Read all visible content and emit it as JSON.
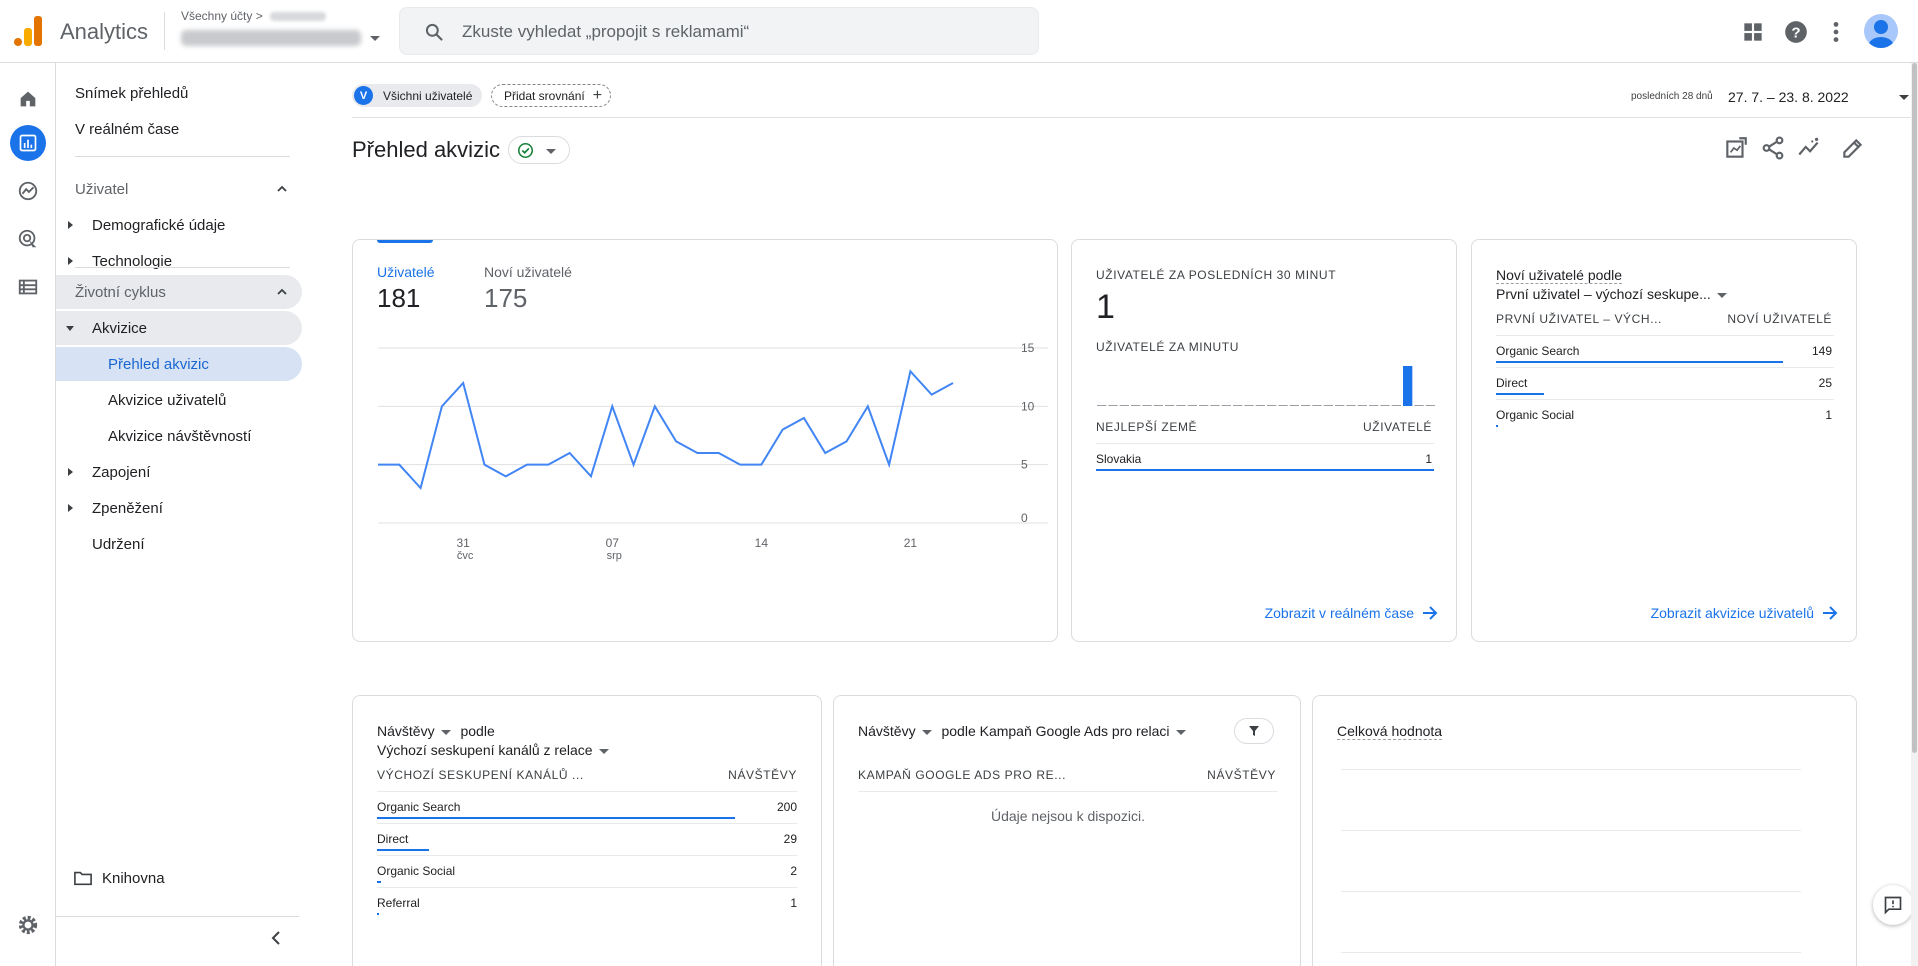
{
  "app": {
    "title": "Analytics",
    "account_crumb": "Všechny účty",
    "crumb_sep": ">"
  },
  "search": {
    "placeholder": "Zkuste vyhledat „propojit s reklamami“"
  },
  "sidebar": {
    "items": [
      {
        "label": "Snímek přehledů"
      },
      {
        "label": "V reálném čase"
      },
      {
        "label": "Uživatel"
      },
      {
        "label": "Demografické údaje"
      },
      {
        "label": "Technologie"
      },
      {
        "label": "Životní cyklus"
      },
      {
        "label": "Akvizice"
      },
      {
        "label": "Přehled akvizic"
      },
      {
        "label": "Akvizice uživatelů"
      },
      {
        "label": "Akvizice návštěvností"
      },
      {
        "label": "Zapojení"
      },
      {
        "label": "Zpeněžení"
      },
      {
        "label": "Udržení"
      }
    ],
    "library": "Knihovna"
  },
  "header": {
    "chip_users": "Všichni uživatelé",
    "chip_users_avatar": "V",
    "chip_add": "Přidat srovnání",
    "date_label": "posledních 28 dnů",
    "date_range": "27. 7. – 23. 8. 2022",
    "page_title": "Přehled akvizic"
  },
  "overview_card": {
    "metric1_label": "Uživatelé",
    "metric1_value": "181",
    "metric2_label": "Noví uživatelé",
    "metric2_value": "175"
  },
  "chart_data": {
    "type": "line",
    "series": [
      {
        "name": "Uživatelé",
        "values": [
          5,
          5,
          3,
          10,
          12,
          5,
          4,
          5,
          5,
          6,
          4,
          10,
          5,
          10,
          7,
          6,
          6,
          5,
          5,
          8,
          9,
          6,
          7,
          10,
          5,
          13,
          11,
          12
        ]
      }
    ],
    "x_ticks": [
      {
        "index": 4,
        "label": "31",
        "sublabel": "čvc"
      },
      {
        "index": 11,
        "label": "07",
        "sublabel": "srp"
      },
      {
        "index": 18,
        "label": "14",
        "sublabel": ""
      },
      {
        "index": 25,
        "label": "21",
        "sublabel": ""
      }
    ],
    "y_ticks": [
      "0",
      "5",
      "10",
      "15"
    ],
    "ylim": [
      0,
      15
    ],
    "color": "#4285f4"
  },
  "realtime_card": {
    "title": "UŽIVATELÉ ZA POSLEDNÍCH 30 MINUT",
    "value": "1",
    "subtitle": "UŽIVATELÉ ZA MINUTU",
    "minute_bars": [
      0,
      0,
      0,
      0,
      0,
      0,
      0,
      0,
      0,
      0,
      0,
      0,
      0,
      0,
      0,
      0,
      0,
      0,
      0,
      0,
      0,
      0,
      0,
      0,
      0,
      0,
      0,
      1,
      0,
      0
    ],
    "col1": "NEJLEPŠÍ ZEMĚ",
    "col2": "UŽIVATELÉ",
    "rows": [
      {
        "label": "Slovakia",
        "value": "1"
      }
    ],
    "link": "Zobrazit v reálném čase"
  },
  "new_users_card": {
    "title": "Noví uživatelé podle",
    "dimension": "První uživatel – výchozí seskupe...",
    "col1": "PRVNÍ UŽIVATEL – VÝCH...",
    "col2": "NOVÍ UŽIVATELÉ",
    "rows": [
      {
        "label": "Organic Search",
        "value": "149"
      },
      {
        "label": "Direct",
        "value": "25"
      },
      {
        "label": "Organic Social",
        "value": "1"
      }
    ],
    "link": "Zobrazit akvizice uživatelů"
  },
  "sessions_card": {
    "metric": "Návštěvy",
    "by": "podle",
    "dimension": "Výchozí seskupení kanálů z relace",
    "col1": "VÝCHOZÍ SESKUPENÍ KANÁLŮ ...",
    "col2": "NÁVŠTĚVY",
    "rows": [
      {
        "label": "Organic Search",
        "value": "200"
      },
      {
        "label": "Direct",
        "value": "29"
      },
      {
        "label": "Organic Social",
        "value": "2"
      },
      {
        "label": "Referral",
        "value": "1"
      }
    ]
  },
  "ads_card": {
    "metric": "Návštěvy",
    "by": "podle Kampaň Google Ads pro relaci",
    "col1": "KAMPAŇ GOOGLE ADS PRO RE...",
    "col2": "NÁVŠTĚVY",
    "empty": "Údaje nejsou k dispozici."
  },
  "value_card": {
    "title": "Celková hodnota"
  },
  "colors": {
    "accent": "#1a73e8",
    "selected_bg": "#d7e3f4",
    "border": "#dadce0"
  }
}
